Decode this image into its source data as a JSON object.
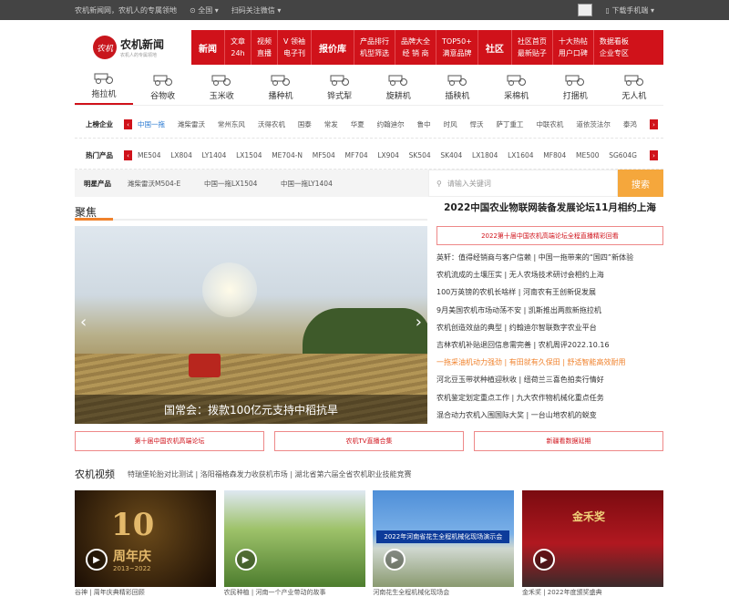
{
  "topbar": {
    "slogan": "农机新闻网，农机人的专属领地",
    "location": "全国",
    "follow": "扫码关注微信",
    "download": "下载手机端"
  },
  "logo": {
    "mark": "农机",
    "title": "农机新闻",
    "subtitle": "农机人的专属领地"
  },
  "rednav": [
    {
      "type": "big",
      "label": "新闻"
    },
    {
      "type": "col",
      "top": "文章",
      "bottom": "24h"
    },
    {
      "type": "col",
      "top": "视频",
      "bottom": "直播"
    },
    {
      "type": "col",
      "top": "V 领袖",
      "bottom": "电子刊"
    },
    {
      "type": "big",
      "label": "报价库"
    },
    {
      "type": "col",
      "top": "产品排行",
      "bottom": "机型筛选"
    },
    {
      "type": "col",
      "top": "品牌大全",
      "bottom": "经 销 商"
    },
    {
      "type": "col",
      "top": "TOP50+",
      "bottom": "满意品牌"
    },
    {
      "type": "big",
      "label": "社区"
    },
    {
      "type": "col",
      "top": "社区首页",
      "bottom": "最新贴子"
    },
    {
      "type": "col",
      "top": "十大热帖",
      "bottom": "用户口碑"
    },
    {
      "type": "col",
      "top": "数据看板",
      "bottom": "企业专区"
    }
  ],
  "categories": [
    "拖拉机",
    "谷物收",
    "玉米收",
    "播种机",
    "铧式犁",
    "旋耕机",
    "插秧机",
    "采棉机",
    "打捆机",
    "无人机"
  ],
  "brands": {
    "label": "上榜企业",
    "items": [
      "中国一拖",
      "潍柴雷沃",
      "常州东风",
      "沃得农机",
      "国泰",
      "常发",
      "华夏",
      "约翰迪尔",
      "鲁中",
      "时风",
      "悍沃",
      "萨丁重工",
      "中联农机",
      "道依茨法尔",
      "泰鸿"
    ]
  },
  "products": {
    "label": "热门产品",
    "items": [
      "ME504",
      "LX804",
      "LY1404",
      "LX1504",
      "ME704-N",
      "MF504",
      "MF704",
      "LX904",
      "SK504",
      "SK404",
      "LX1804",
      "LX1604",
      "MF804",
      "ME500",
      "SG604G"
    ]
  },
  "stars": {
    "label": "明星产品",
    "items": [
      "潍柴雷沃M504-E",
      "中国一拖LX1504",
      "中国一拖LY1404"
    ]
  },
  "search": {
    "placeholder": "请输入关键词",
    "button": "搜索"
  },
  "focus": {
    "title": "聚焦",
    "caption": "国常会：拨款100亿元支持中稻抗旱"
  },
  "headline": "2022中国农业物联网装备发展论坛11月相约上海",
  "redbox": "2022第十届中国农机高端论坛全程直播精彩回看",
  "news": [
    {
      "text": "英轩：值得经销商与客户信赖 | 中国一拖带来的“国四”新体验",
      "hi": false
    },
    {
      "text": "农机流成的土壤压实 | 无人农场技术研讨会相约上海",
      "hi": false
    },
    {
      "text": "100万英镑的农机长啥样 | 河南农有王创新促发展",
      "hi": false
    },
    {
      "text": "9月美国农机市场动荡不安 | 凯斯推出两款新拖拉机",
      "hi": false
    },
    {
      "text": "农机创造效益的典型 | 约翰迪尔智联数字农业平台",
      "hi": false
    },
    {
      "text": "吉林农机补贴退回信息需完善 | 农机周评2022.10.16",
      "hi": false
    },
    {
      "text": "一拖采油机动力强劲 | 有田就有久保田 | 舒适智能高效耐用",
      "hi": true
    },
    {
      "text": "河北豆玉带状种植迎秋收 | 纽荷兰三喜色拍卖行情好",
      "hi": false
    },
    {
      "text": "农机鉴定划定重点工作 | 九大农作物机械化重点任务",
      "hi": false
    },
    {
      "text": "混合动力农机入围国际大奖 | 一台山地农机的蜕变",
      "hi": false
    }
  ],
  "buttons": [
    "第十届中国农机高端论坛",
    "农机TV直播合集",
    "新疆看数据延期"
  ],
  "video": {
    "title": "农机视频",
    "sub": "特瑞堡轮胎对比测试 | 洛阳福格森发力收获机市场 | 湖北省第六届全省农机职业技能竞赛",
    "v1_big": "10",
    "v1_sub": "周年庆",
    "v1_year": "2013~2022",
    "v3_banner": "2022年河南省花生全程机械化现场演示会",
    "v4_text": "金禾奖"
  },
  "bottom_caps": [
    "谷神 | 周年庆典精彩回顾",
    "农民种植 | 河南一个产业带动的故事",
    "河南花生全程机械化现场会",
    "金禾奖 | 2022年度颁奖盛典"
  ],
  "colors": {
    "brand_red": "#d0121a",
    "accent_orange": "#f5a73c",
    "link_blue": "#2a7ad2"
  }
}
